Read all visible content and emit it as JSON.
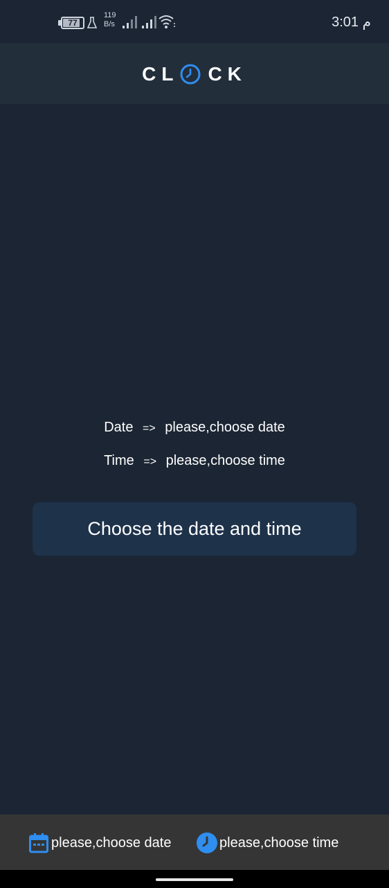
{
  "status_bar": {
    "battery_level": "77",
    "net_speed_value": "119",
    "net_speed_unit": "B/s",
    "time": "3:01 م"
  },
  "app_bar": {
    "logo_left": "CL",
    "logo_right": "CK"
  },
  "content": {
    "date_label": "Date",
    "date_arrow": "=>",
    "date_value": "please,choose date",
    "time_label": "Time",
    "time_arrow": "=>",
    "time_value": "please,choose time",
    "button_label": "Choose the date and time"
  },
  "bottom_bar": {
    "date_text": "please,choose date",
    "time_text": "please,choose time"
  },
  "colors": {
    "background": "#1b2533",
    "app_bar": "#232e3b",
    "button": "#1e324a",
    "accent": "#2f8ef0",
    "bottom_bar": "#353535"
  }
}
